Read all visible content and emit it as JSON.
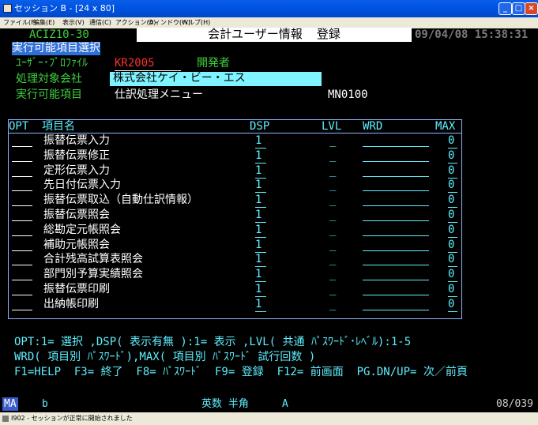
{
  "window": {
    "title": "セッション B - [24 x 80]",
    "menu": [
      "ファイル(F)",
      "編集(E)",
      "表示(V)",
      "通信(C)",
      "アクション(A)",
      "ウィンドウ(W)",
      "ヘルプ(H)"
    ]
  },
  "screen": {
    "program_id": "ACIZ10-30",
    "title": "会計ユーザー情報  登録",
    "datetime": "09/04/08 15:38:31",
    "section_label": "実行可能項目選択",
    "user_profile_label": "ﾕｰｻﾞｰ･ﾌﾟﾛﾌｧｲﾙ",
    "user_profile_value": "KR2005",
    "user_role": "開発者",
    "company_label": "処理対象会社",
    "company_value": "株式会社ケイ・ビー・エス",
    "executable_label": "実行可能項目",
    "executable_value": "仕訳処理メニュー",
    "menu_code": "MN0100"
  },
  "table": {
    "headers": {
      "opt": "OPT",
      "name": "項目名",
      "dsp": "DSP",
      "lvl": "LVL",
      "wrd": "WRD",
      "max": "MAX"
    },
    "rows": [
      {
        "name": "振替伝票入力",
        "dsp": "1",
        "lvl": "_",
        "max": "0"
      },
      {
        "name": "振替伝票修正",
        "dsp": "1",
        "lvl": "_",
        "max": "0"
      },
      {
        "name": "定形伝票入力",
        "dsp": "1",
        "lvl": "_",
        "max": "0"
      },
      {
        "name": "先日付伝票入力",
        "dsp": "1",
        "lvl": "_",
        "max": "0"
      },
      {
        "name": "振替伝票取込（自動仕訳情報）",
        "dsp": "1",
        "lvl": "_",
        "max": "0"
      },
      {
        "name": "振替伝票照会",
        "dsp": "1",
        "lvl": "_",
        "max": "0"
      },
      {
        "name": "総勘定元帳照会",
        "dsp": "1",
        "lvl": "_",
        "max": "0"
      },
      {
        "name": "補助元帳照会",
        "dsp": "1",
        "lvl": "_",
        "max": "0"
      },
      {
        "name": "合計残高試算表照会",
        "dsp": "1",
        "lvl": "_",
        "max": "0"
      },
      {
        "name": "部門別予算実績照会",
        "dsp": "1",
        "lvl": "_",
        "max": "0"
      },
      {
        "name": "振替伝票印刷",
        "dsp": "1",
        "lvl": "_",
        "max": "0"
      },
      {
        "name": "出納帳印刷",
        "dsp": "1",
        "lvl": "_",
        "max": "0"
      }
    ]
  },
  "help": {
    "line1": "OPT:1= 選択 ,DSP( 表示有無 ):1= 表示 ,LVL( 共通 ﾊﾟｽﾜｰﾄﾞ･ﾚﾍﾞﾙ):1-5",
    "line2": "WRD( 項目別 ﾊﾟｽﾜｰﾄﾞ),MAX( 項目別 ﾊﾟｽﾜｰﾄﾞ 試行回数 )",
    "line3": "F1=HELP  F3= 終了  F8= ﾊﾟｽﾜｰﾄﾞ  F9= 登録  F12= 前画面  PG.DN/UP= 次／前頁"
  },
  "status": {
    "indicator": "MA",
    "b": "b",
    "mode": "英数 半角",
    "a": "A",
    "cursor": "08/039",
    "message": "I902 - セッションが正常に開始されました"
  },
  "colors": {
    "field_green": "#3dd13d",
    "field_cyan": "#5ff0ff",
    "accent_red": "#ff3030",
    "bar_blue": "#2f6fd8"
  }
}
